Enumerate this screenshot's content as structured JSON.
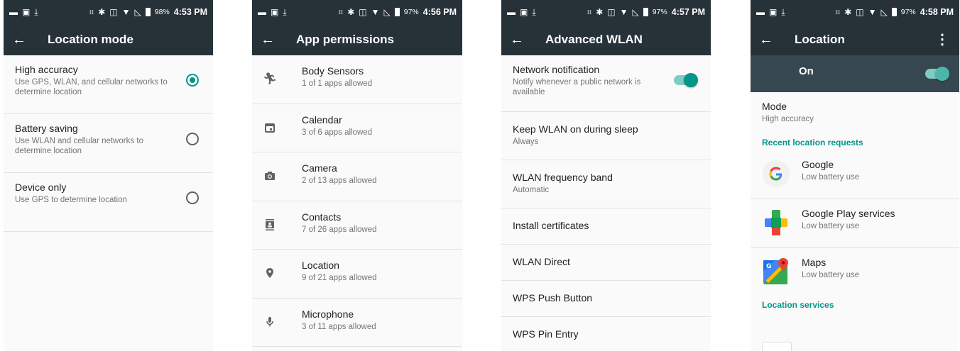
{
  "screens": [
    {
      "status": {
        "battery": "98%",
        "time": "4:53 PM"
      },
      "title": "Location mode",
      "options": [
        {
          "title": "High accuracy",
          "subtitle": "Use GPS, WLAN, and cellular networks to determine location",
          "selected": true
        },
        {
          "title": "Battery saving",
          "subtitle": "Use WLAN and cellular networks to determine location",
          "selected": false
        },
        {
          "title": "Device only",
          "subtitle": "Use GPS to determine location",
          "selected": false
        }
      ]
    },
    {
      "status": {
        "battery": "97%",
        "time": "4:56 PM"
      },
      "title": "App permissions",
      "items": [
        {
          "icon": "body-sensors-icon",
          "title": "Body Sensors",
          "subtitle": "1 of 1 apps allowed"
        },
        {
          "icon": "calendar-icon",
          "title": "Calendar",
          "subtitle": "3 of 6 apps allowed"
        },
        {
          "icon": "camera-icon",
          "title": "Camera",
          "subtitle": "2 of 13 apps allowed"
        },
        {
          "icon": "contacts-icon",
          "title": "Contacts",
          "subtitle": "7 of 26 apps allowed"
        },
        {
          "icon": "location-pin-icon",
          "title": "Location",
          "subtitle": "9 of 21 apps allowed"
        },
        {
          "icon": "microphone-icon",
          "title": "Microphone",
          "subtitle": "3 of 11 apps allowed"
        }
      ]
    },
    {
      "status": {
        "battery": "97%",
        "time": "4:57 PM"
      },
      "title": "Advanced WLAN",
      "items": [
        {
          "title": "Network notification",
          "subtitle": "Notify whenever a public network is available",
          "toggle": true
        },
        {
          "title": "Keep WLAN on during sleep",
          "subtitle": "Always"
        },
        {
          "title": "WLAN frequency band",
          "subtitle": "Automatic"
        },
        {
          "title": "Install certificates",
          "subtitle": ""
        },
        {
          "title": "WLAN Direct",
          "subtitle": ""
        },
        {
          "title": "WPS Push Button",
          "subtitle": ""
        },
        {
          "title": "WPS Pin Entry",
          "subtitle": ""
        }
      ]
    },
    {
      "status": {
        "battery": "97%",
        "time": "4:58 PM"
      },
      "title": "Location",
      "master_switch": {
        "label": "On",
        "on": true
      },
      "mode": {
        "title": "Mode",
        "value": "High accuracy"
      },
      "recent_header": "Recent location requests",
      "apps": [
        {
          "icon": "google-icon",
          "name": "Google",
          "usage": "Low battery use"
        },
        {
          "icon": "google-play-services-icon",
          "name": "Google Play services",
          "usage": "Low battery use"
        },
        {
          "icon": "maps-icon",
          "name": "Maps",
          "usage": "Low battery use"
        }
      ],
      "services_header": "Location services"
    }
  ],
  "colors": {
    "toolbar": "#263238",
    "accent": "#009688",
    "switch_bar": "#37474f"
  }
}
